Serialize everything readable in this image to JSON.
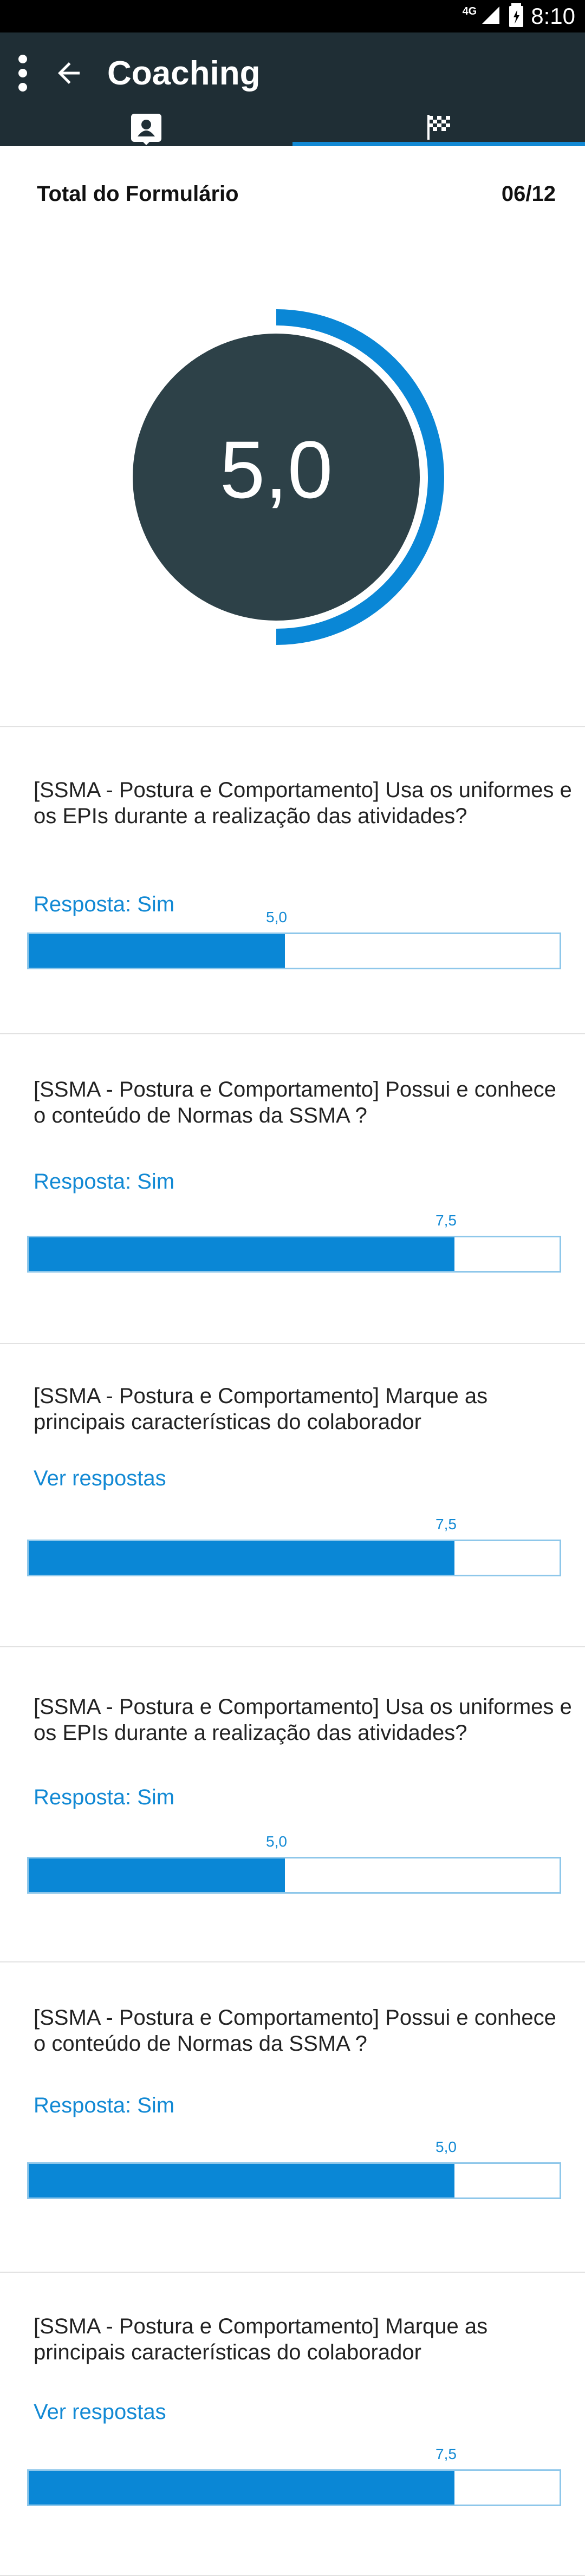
{
  "status_bar": {
    "network": "4G",
    "time": "8:10"
  },
  "toolbar": {
    "title": "Coaching"
  },
  "tabs": [
    {
      "name": "profile",
      "icon": "contact-card-icon",
      "active": true
    },
    {
      "name": "results",
      "icon": "checkered-flag-icon",
      "active": false
    }
  ],
  "summary": {
    "label": "Total do Formulário",
    "count": "06/12",
    "score": "5,0",
    "progress": 0.5
  },
  "questions": [
    {
      "text": "[SSMA - Postura e Comportamento] Usa os uniformes e os EPIs durante a realização das atividades?",
      "answer": "Resposta: Sim",
      "score_label": "5,0",
      "fill": 0.48
    },
    {
      "text": "[SSMA - Postura e Comportamento] Possui e conhece o conteúdo de Normas da SSMA ?",
      "answer": "Resposta: Sim",
      "score_label": "7,5",
      "fill": 0.797
    },
    {
      "text": "[SSMA - Postura e Comportamento] Marque as principais características do colaborador",
      "answer": "Ver respostas",
      "score_label": "7,5",
      "fill": 0.797
    },
    {
      "text": "[SSMA - Postura e Comportamento] Usa os uniformes e os EPIs durante a realização das atividades?",
      "answer": "Resposta: Sim",
      "score_label": "5,0",
      "fill": 0.48
    },
    {
      "text": "[SSMA - Postura e Comportamento] Possui e conhece o conteúdo de Normas da SSMA ?",
      "answer": "Resposta: Sim",
      "score_label": "5,0",
      "fill": 0.797
    },
    {
      "text": "[SSMA - Postura e Comportamento] Marque as principais características do colaborador",
      "answer": "Ver respostas",
      "score_label": "7,5",
      "fill": 0.797
    }
  ],
  "colors": {
    "appbar": "#1f2e35",
    "accent": "#0a87d6",
    "gauge_center": "#2d4148"
  }
}
